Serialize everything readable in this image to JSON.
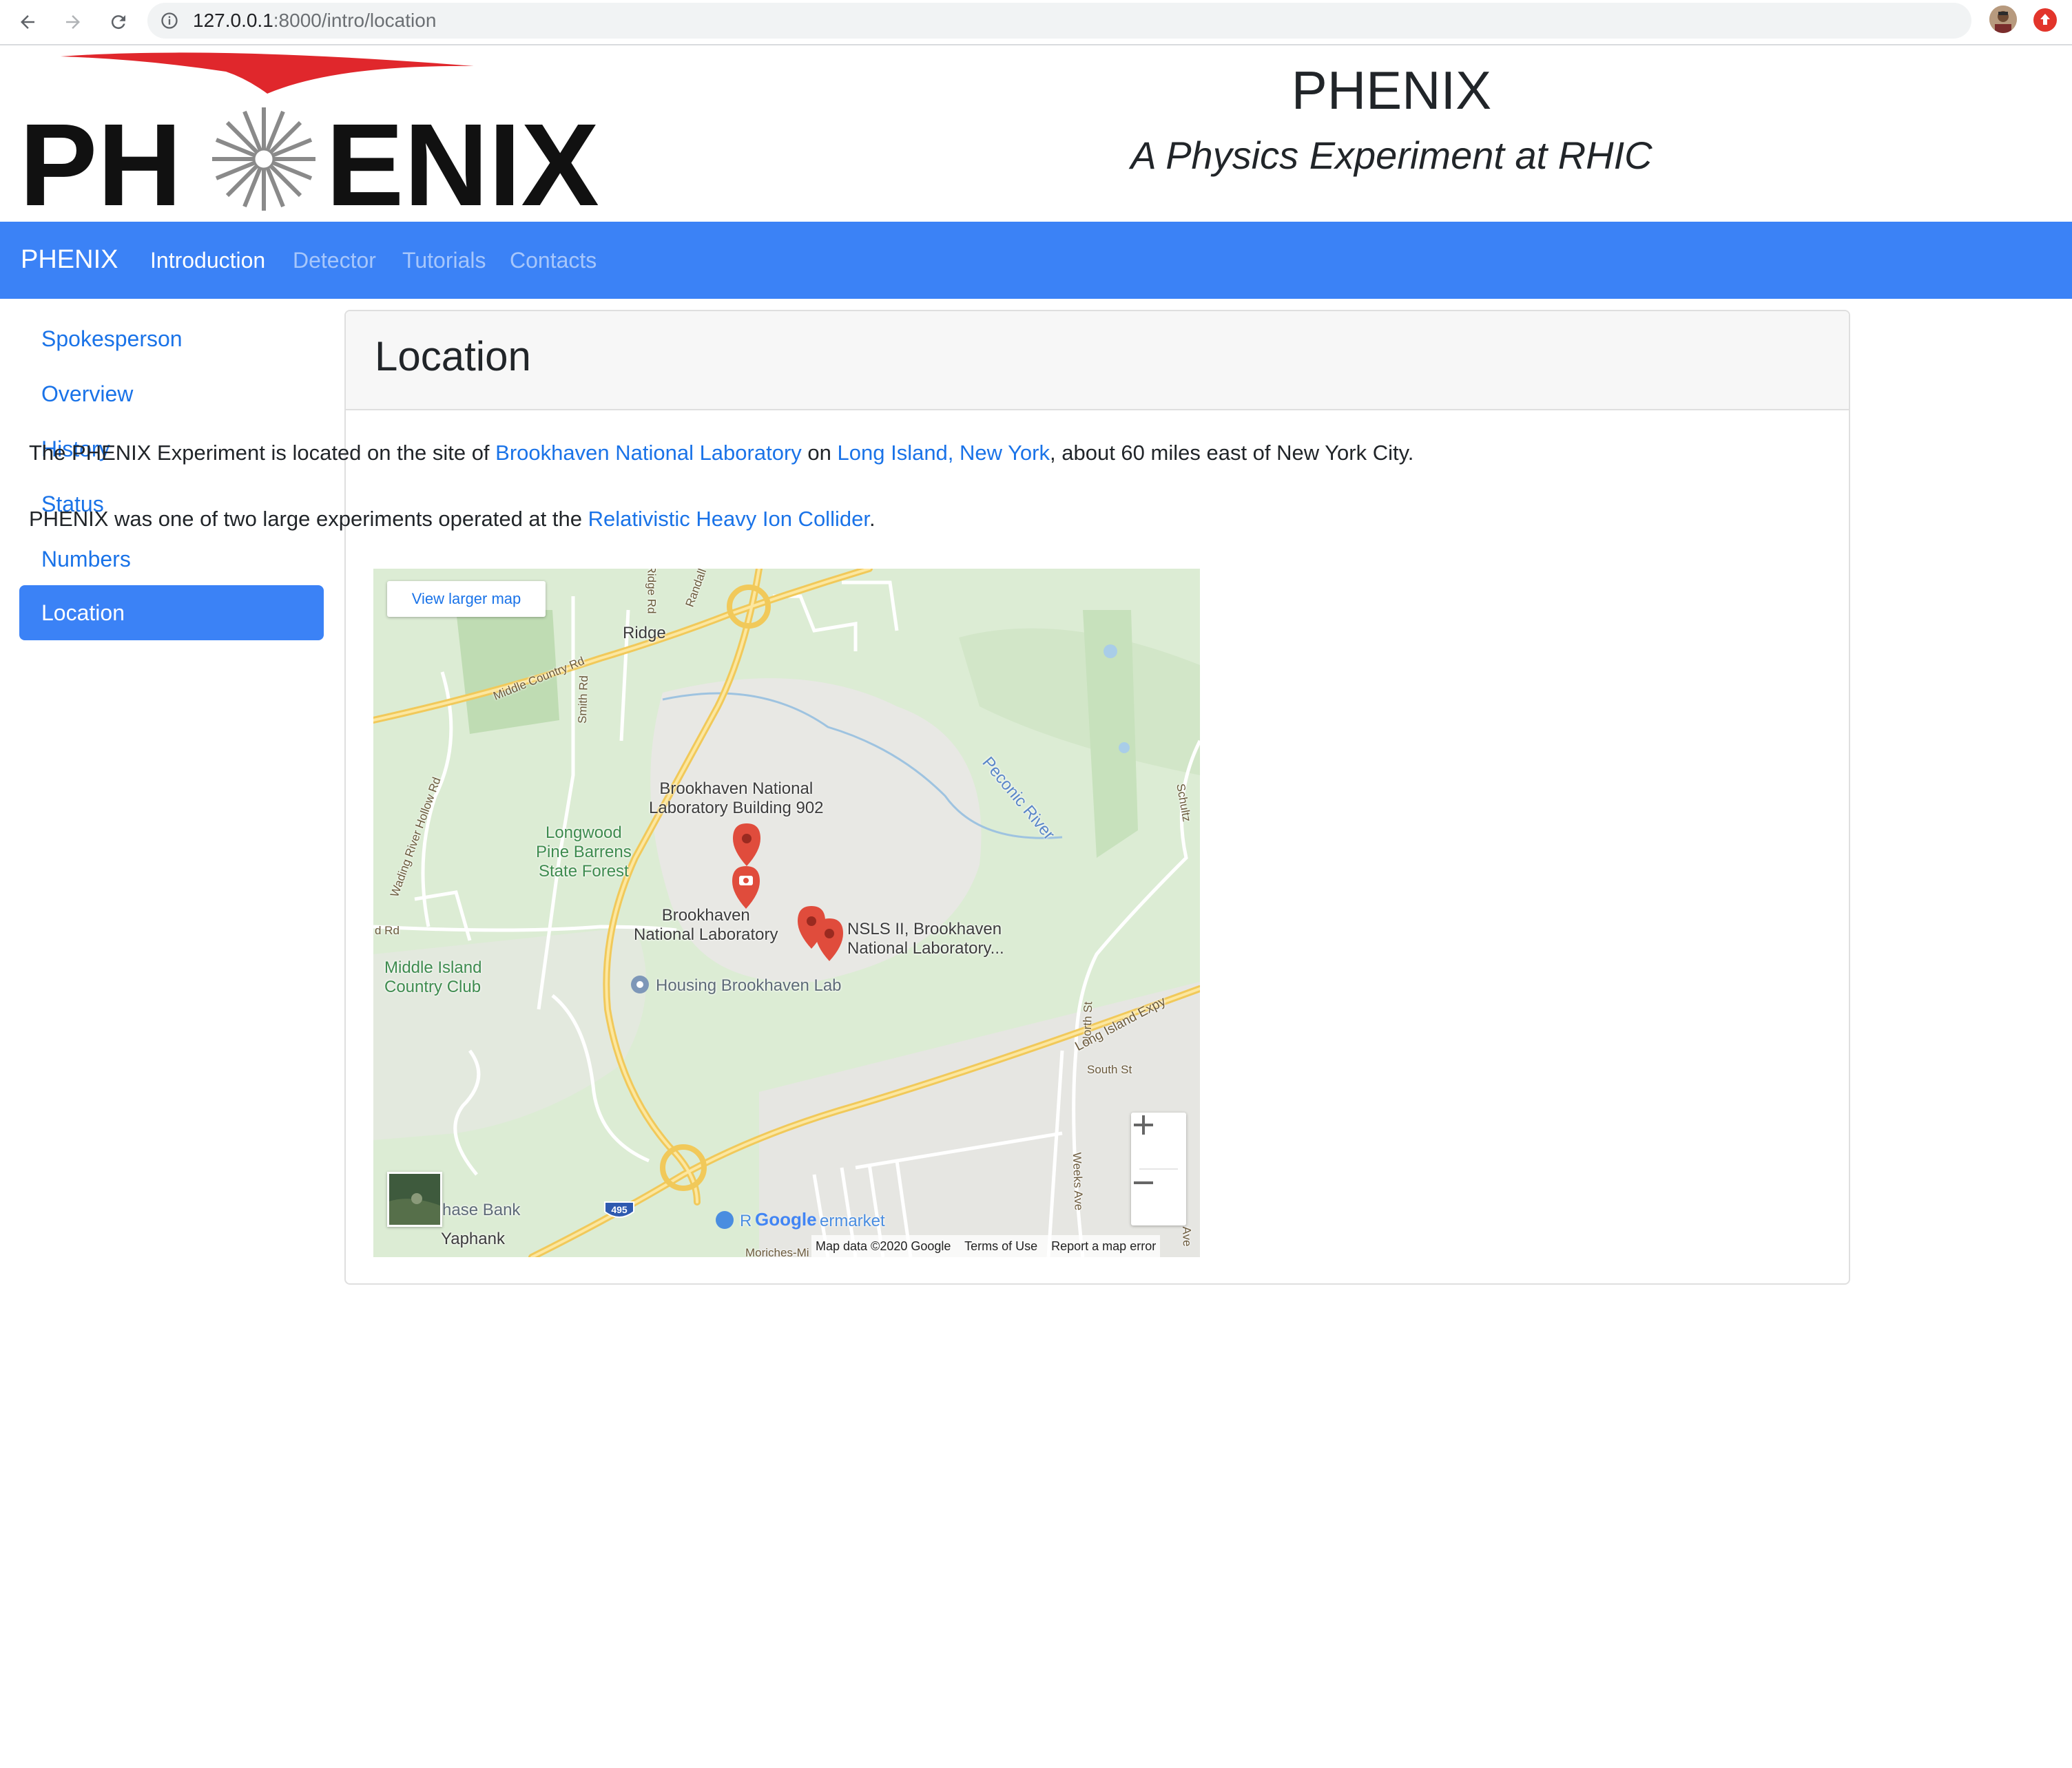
{
  "browser": {
    "url_host": "127.0.0.1",
    "url_rest": ":8000/intro/location",
    "icons": [
      "back-arrow-icon",
      "forward-arrow-icon",
      "reload-icon",
      "info-icon",
      "star-icon",
      "avatar",
      "extension-icon"
    ]
  },
  "header": {
    "logo_text": "PHENIX",
    "title": "PHENIX",
    "subtitle": "A Physics Experiment at RHIC"
  },
  "navbar": {
    "brand": "PHENIX",
    "links": [
      {
        "label": "Introduction",
        "active": true
      },
      {
        "label": "Detector",
        "active": false
      },
      {
        "label": "Tutorials",
        "active": false
      },
      {
        "label": "Contacts",
        "active": false
      }
    ]
  },
  "sidebar": {
    "items": [
      {
        "label": "Spokesperson"
      },
      {
        "label": "Overview"
      },
      {
        "label": "History"
      },
      {
        "label": "Status"
      },
      {
        "label": "Numbers"
      },
      {
        "label": "Location",
        "active": true
      }
    ]
  },
  "content": {
    "heading": "Location",
    "p1": {
      "t1": "The PHENIX Experiment is located on the site of ",
      "link1": "Brookhaven National Laboratory",
      "t2": " on ",
      "link2": "Long Island, New York",
      "t3": ", about 60 miles east of New York City."
    },
    "p2": {
      "t1": "PHENIX was one of two large experiments operated at the ",
      "link1": "Relativistic Heavy Ion Collider",
      "t2": "."
    }
  },
  "map": {
    "view_larger": "View larger map",
    "labels": {
      "ridge": "Ridge",
      "middle_country": "Middle Country Rd",
      "ridge_rd": "Ridge Rd",
      "randall": "Randall",
      "smith_rd": "Smith Rd",
      "wading_river": "Wading River Hollow Rd",
      "bnl_902": "Brookhaven National\nLaboratory Building 902",
      "longwood": "Longwood\nPine Barrens\nState Forest",
      "peconic": "Peconic River",
      "schultz": "Schultz",
      "bnl": "Brookhaven\nNational Laboratory",
      "nsls": "NSLS II, Brookhaven\nNational Laboratory...",
      "rd": "d Rd",
      "middle_island": "Middle Island\nCountry Club",
      "housing": "Housing Brookhaven Lab",
      "north_st": "North St",
      "lie": "Long Island Expy",
      "south_st": "South St",
      "weeks": "Weeks Ave",
      "ave": "Ave",
      "chase": "hase Bank",
      "yaphank": "Yaphank",
      "i495": "495",
      "market": "R",
      "market2": "ermarket",
      "moriches": "Moriches-Mi"
    },
    "google": "Google",
    "attribution": [
      "Map data ©2020 Google",
      "Terms of Use",
      "Report a map error"
    ],
    "zoom_in": "+",
    "zoom_out": "−"
  },
  "colors": {
    "navbar": "#3b82f6",
    "link": "#1a73e8",
    "map_bg": "#dcecd4",
    "map_road": "#f5d67a",
    "marker": "#e04c3c"
  }
}
